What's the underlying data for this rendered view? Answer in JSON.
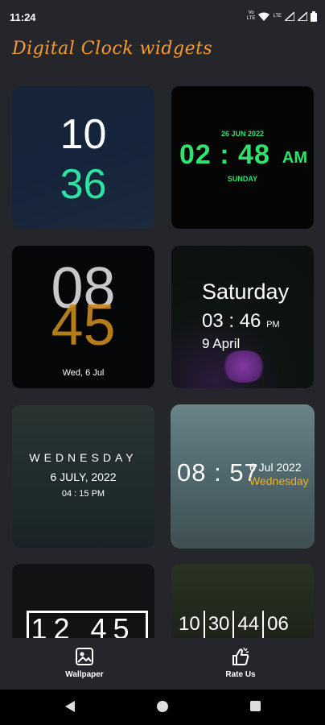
{
  "status_bar": {
    "time": "11:24",
    "icons": [
      "volte-icon",
      "wifi-icon",
      "lte-icon",
      "signal-icon",
      "battery-icon"
    ]
  },
  "app": {
    "title": "Digital Clock widgets",
    "title_color": "#f39a33"
  },
  "widgets": [
    {
      "hour": "10",
      "minute": "36",
      "minute_color": "#2ce3a4"
    },
    {
      "date": "26 JUN 2022",
      "time": "02 : 48",
      "ampm": "AM",
      "day": "SUNDAY",
      "color": "#2ee36e"
    },
    {
      "hour": "08",
      "minute": "45",
      "date": "Wed, 6 Jul",
      "minute_color": "#c98a1c"
    },
    {
      "day": "Saturday",
      "time": "03 : 46",
      "ampm": "PM",
      "date": "9 April"
    },
    {
      "day": "WEDNESDAY",
      "date": "6 JULY, 2022",
      "time": "04 : 15 PM"
    },
    {
      "time": "08 : 57",
      "date": "6 Jul 2022",
      "day": "Wednesday",
      "day_color": "#f1b21d"
    },
    {
      "time": "12 45"
    },
    {
      "segments": [
        "10",
        "30",
        "44",
        "06"
      ]
    }
  ],
  "bottom_nav": {
    "wallpaper_label": "Wallpaper",
    "rate_label": "Rate Us"
  }
}
